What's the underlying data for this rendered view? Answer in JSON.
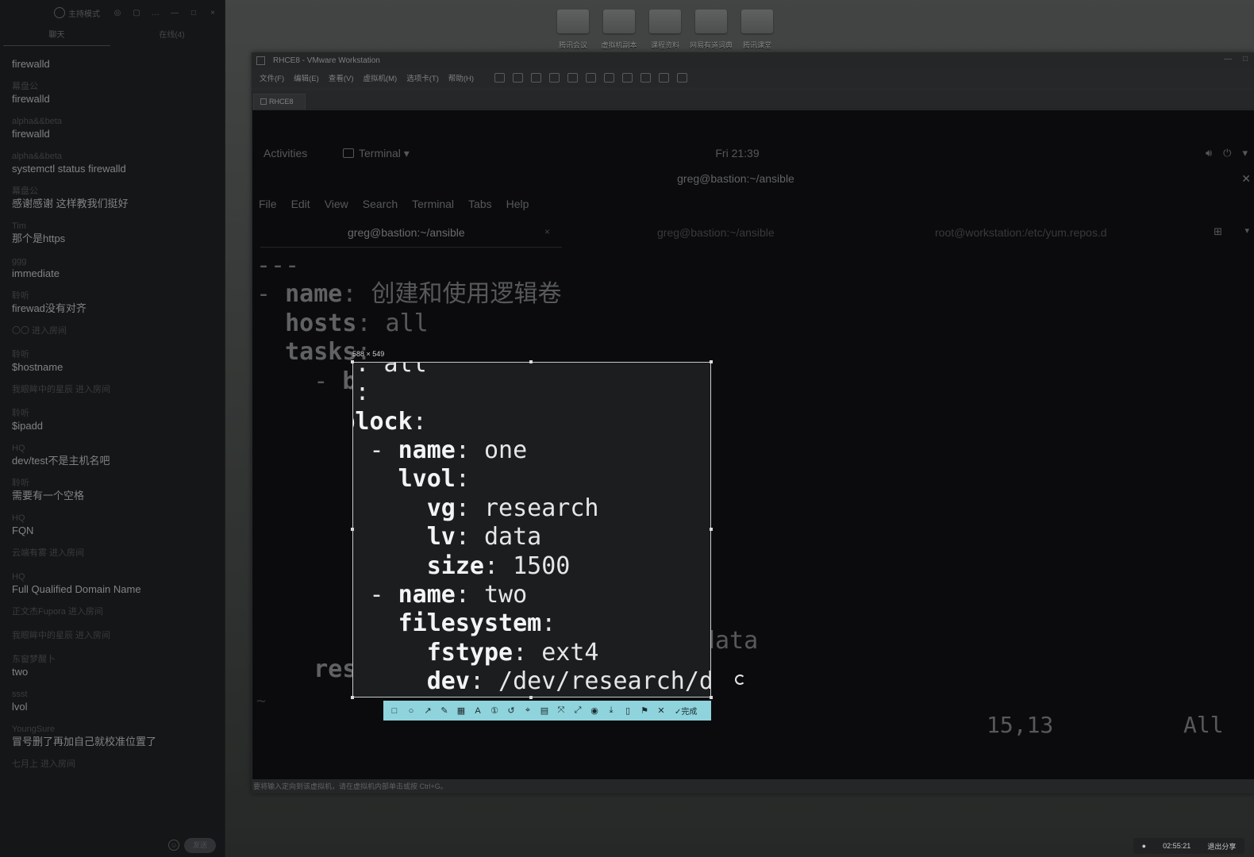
{
  "chat": {
    "header_mode": "主持模式",
    "tabs": [
      "聊天",
      "在线(4)"
    ],
    "messages": [
      {
        "user": "",
        "text": "firewalld"
      },
      {
        "user": "幕盘公",
        "text": "firewalld"
      },
      {
        "user": "alpha&&beta",
        "text": "firewalld"
      },
      {
        "user": "alpha&&beta",
        "text": "systemctl status firewalld"
      },
      {
        "user": "幕盘公",
        "text": "感谢感谢  这样教我们挺好"
      },
      {
        "user": "Tim",
        "text": "那个是https"
      },
      {
        "user": "ggg",
        "text": "immediate"
      },
      {
        "user": "聆听",
        "text": "firewad没有对齐"
      },
      {
        "system": "〇〇 进入房间"
      },
      {
        "user": "聆听",
        "text": "$hostname"
      },
      {
        "system": "我眼眸中的星辰 进入房间"
      },
      {
        "user": "聆听",
        "text": "$ipadd"
      },
      {
        "user": "HQ",
        "text": "dev/test不是主机名吧"
      },
      {
        "user": "聆听",
        "text": "需要有一个空格"
      },
      {
        "user": "HQ",
        "text": "FQN"
      },
      {
        "system": "云端有雾 进入房间"
      },
      {
        "user": "HQ",
        "text": "Full Qualified Domain Name"
      },
      {
        "system": "正文杰Fupora 进入房间"
      },
      {
        "system": "我眼眸中的星辰 进入房间"
      },
      {
        "user": "东窗梦醒卜",
        "text": "two"
      },
      {
        "user": "ssst",
        "text": "lvol"
      },
      {
        "user": "YoungSure",
        "text": "冒号删了再加自己就校准位置了"
      },
      {
        "system": "七月上 进入房间"
      }
    ],
    "send_label": "发送"
  },
  "desktop_icons": [
    "腾讯会议",
    "虚拟机副本",
    "课程资料",
    "网易有道词典",
    "腾讯课堂"
  ],
  "vmware": {
    "title": "RHCE8 - VMware Workstation",
    "menu": [
      "文件(F)",
      "编辑(E)",
      "查看(V)",
      "虚拟机(M)",
      "选项卡(T)",
      "帮助(H)"
    ],
    "tab": "RHCE8",
    "status": "要将输入定向到该虚拟机，请在虚拟机内部单击或按 Ctrl+G。"
  },
  "gnome": {
    "activities": "Activities",
    "app_menu": "Terminal",
    "clock": "Fri 21:39"
  },
  "terminal": {
    "title": "greg@bastion:~/ansible",
    "menu": [
      "File",
      "Edit",
      "View",
      "Search",
      "Terminal",
      "Tabs",
      "Help"
    ],
    "tabs": [
      {
        "label": "greg@bastion:~/ansible",
        "active": true
      },
      {
        "label": "greg@bastion:~/ansible",
        "active": false
      },
      {
        "label": "root@workstation:/etc/yum.repos.d",
        "active": false
      }
    ]
  },
  "vim": {
    "lines": [
      [
        {
          "t": "---",
          "c": "v"
        }
      ],
      [
        {
          "t": "- ",
          "c": "v"
        },
        {
          "t": "name",
          "c": "k"
        },
        {
          "t": ": 创建和使用逻辑卷",
          "c": "v"
        }
      ],
      [
        {
          "t": "  ",
          "c": "v"
        },
        {
          "t": "hosts",
          "c": "k"
        },
        {
          "t": ": all",
          "c": "v"
        }
      ],
      [
        {
          "t": "  ",
          "c": "v"
        },
        {
          "t": "tasks",
          "c": "k"
        },
        {
          "t": ":",
          "c": "v"
        }
      ],
      [
        {
          "t": "    - ",
          "c": "v"
        },
        {
          "t": "block",
          "c": "k"
        },
        {
          "t": ":",
          "c": "v"
        }
      ],
      [
        {
          "t": "        - ",
          "c": "v"
        },
        {
          "t": "name",
          "c": "k"
        },
        {
          "t": ": one",
          "c": "v"
        }
      ],
      [
        {
          "t": "          ",
          "c": "v"
        },
        {
          "t": "lvol",
          "c": "k"
        },
        {
          "t": ":",
          "c": "v"
        }
      ],
      [
        {
          "t": "            ",
          "c": "v"
        },
        {
          "t": "vg",
          "c": "k"
        },
        {
          "t": ": research",
          "c": "v"
        }
      ],
      [
        {
          "t": "            ",
          "c": "v"
        },
        {
          "t": "lv",
          "c": "k"
        },
        {
          "t": ": data",
          "c": "v"
        }
      ],
      [
        {
          "t": "            ",
          "c": "v"
        },
        {
          "t": "size",
          "c": "k"
        },
        {
          "t": ": 1500",
          "c": "v"
        }
      ],
      [
        {
          "t": "        - ",
          "c": "v"
        },
        {
          "t": "name",
          "c": "k"
        },
        {
          "t": ": two",
          "c": "v"
        }
      ],
      [
        {
          "t": "          ",
          "c": "v"
        },
        {
          "t": "filesystem",
          "c": "k"
        },
        {
          "t": ":",
          "c": "v"
        }
      ],
      [
        {
          "t": "            ",
          "c": "v"
        },
        {
          "t": "fstype",
          "c": "k"
        },
        {
          "t": ": ext4",
          "c": "v"
        }
      ],
      [
        {
          "t": "            ",
          "c": "v"
        },
        {
          "t": "dev",
          "c": "k"
        },
        {
          "t": ": /dev/research/data",
          "c": "v"
        }
      ],
      [
        {
          "t": "    ",
          "c": "v"
        },
        {
          "t": "rescue",
          "c": "k"
        },
        {
          "t": ":",
          "c": "v"
        }
      ]
    ],
    "tilde": "~",
    "cursor_pos": "15,13",
    "scroll": "All"
  },
  "screenshot_tool": {
    "size_label": "588 × 549",
    "done_label": "完成",
    "tools": [
      "rect-tool",
      "ellipse-tool",
      "arrow-tool",
      "pen-tool",
      "mosaic-tool",
      "text-tool",
      "sequence-tool",
      "undo-tool",
      "pin-tool",
      "ocr-tool",
      "translate-tool",
      "scan-tool",
      "record-tool",
      "download-tool",
      "copy-tool",
      "save-tool",
      "cancel-tool"
    ]
  },
  "tray": {
    "timer": "02:55:21",
    "exit_label": "退出分享"
  }
}
